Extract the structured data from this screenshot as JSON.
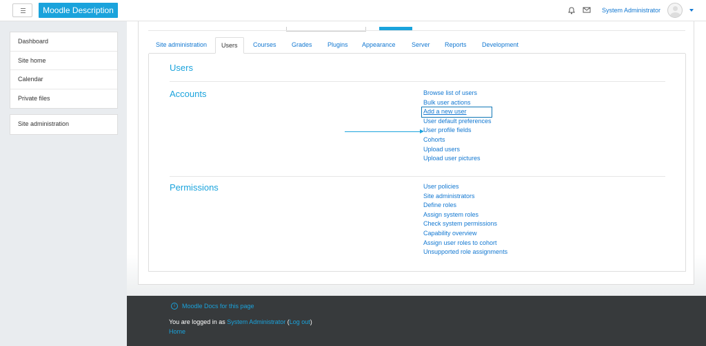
{
  "navbar": {
    "brand": "Moodle Description",
    "user_name": "System Administrator",
    "icons": [
      "hamburger-icon",
      "notifications-icon",
      "messages-icon",
      "user-avatar",
      "caret-down-icon"
    ]
  },
  "drawer": {
    "items": [
      "Dashboard",
      "Site home",
      "Calendar",
      "Private files"
    ],
    "admin_item": "Site administration"
  },
  "tabs": [
    "Site administration",
    "Users",
    "Courses",
    "Grades",
    "Plugins",
    "Appearance",
    "Server",
    "Reports",
    "Development"
  ],
  "active_tab": "Users",
  "content": {
    "heading": "Users",
    "accounts": {
      "title": "Accounts",
      "links": [
        "Browse list of users",
        "Bulk user actions",
        "Add a new user",
        "User default preferences",
        "User profile fields",
        "Cohorts",
        "Upload users",
        "Upload user pictures"
      ]
    },
    "permissions": {
      "title": "Permissions",
      "links": [
        "User policies",
        "Site administrators",
        "Define roles",
        "Assign system roles",
        "Check system permissions",
        "Capability overview",
        "Assign user roles to cohort",
        "Unsupported role assignments"
      ]
    }
  },
  "footer": {
    "docs_link": "Moodle Docs for this page",
    "logged_prefix": "You are logged in as ",
    "logged_user": "System Administrator",
    "logout_open": " (",
    "logout_link": "Log out",
    "logout_close": ")",
    "home_link": "Home"
  },
  "colors": {
    "brand": "#1aa3dc",
    "link": "#1177d1",
    "footer_bg": "#373a3c",
    "page_bg": "#e9ecef"
  }
}
